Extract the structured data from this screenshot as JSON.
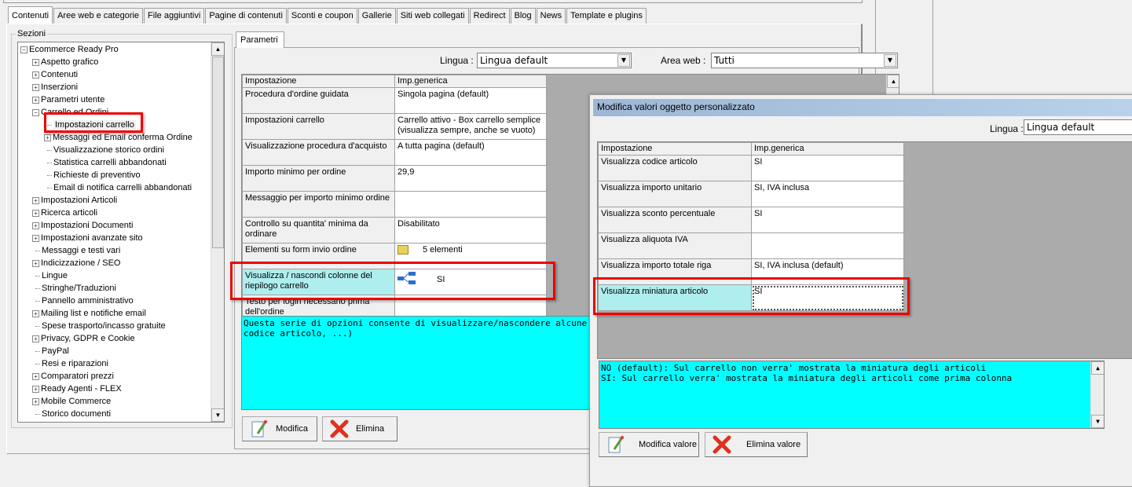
{
  "tabs": [
    "Contenuti",
    "Aree web e categorie",
    "File aggiuntivi",
    "Pagine di contenuti",
    "Sconti e coupon",
    "Gallerie",
    "Siti web collegati",
    "Redirect",
    "Blog",
    "News",
    "Template e plugins"
  ],
  "sections": {
    "label": "Sezioni",
    "root": "Ecommerce Ready Pro",
    "items": [
      {
        "label": "Aspetto grafico",
        "level": 1,
        "exp": "+"
      },
      {
        "label": "Contenuti",
        "level": 1,
        "exp": "+"
      },
      {
        "label": "Inserzioni",
        "level": 1,
        "exp": "+"
      },
      {
        "label": "Parametri utente",
        "level": 1,
        "exp": "+"
      },
      {
        "label": "Carrello ed Ordini",
        "level": 1,
        "exp": "-"
      },
      {
        "label": "Impostazioni carrello",
        "level": 2,
        "exp": "",
        "selected": true
      },
      {
        "label": "Messaggi ed Email conferma Ordine",
        "level": 2,
        "exp": "+"
      },
      {
        "label": "Visualizzazione storico ordini",
        "level": 2,
        "exp": ""
      },
      {
        "label": "Statistica carrelli abbandonati",
        "level": 2,
        "exp": ""
      },
      {
        "label": "Richieste di preventivo",
        "level": 2,
        "exp": ""
      },
      {
        "label": "Email di notifica carrelli abbandonati",
        "level": 2,
        "exp": ""
      },
      {
        "label": "Impostazioni Articoli",
        "level": 1,
        "exp": "+"
      },
      {
        "label": "Ricerca articoli",
        "level": 1,
        "exp": "+"
      },
      {
        "label": "Impostazioni Documenti",
        "level": 1,
        "exp": "+"
      },
      {
        "label": "Impostazioni avanzate sito",
        "level": 1,
        "exp": "+"
      },
      {
        "label": "Messaggi e testi vari",
        "level": 1,
        "exp": ""
      },
      {
        "label": "Indicizzazione / SEO",
        "level": 1,
        "exp": "+"
      },
      {
        "label": "Lingue",
        "level": 1,
        "exp": ""
      },
      {
        "label": "Stringhe/Traduzioni",
        "level": 1,
        "exp": ""
      },
      {
        "label": "Pannello amministrativo",
        "level": 1,
        "exp": ""
      },
      {
        "label": "Mailing list e notifiche email",
        "level": 1,
        "exp": "+"
      },
      {
        "label": "Spese trasporto/incasso gratuite",
        "level": 1,
        "exp": ""
      },
      {
        "label": "Privacy, GDPR e Cookie",
        "level": 1,
        "exp": "+"
      },
      {
        "label": "PayPal",
        "level": 1,
        "exp": ""
      },
      {
        "label": "Resi e riparazioni",
        "level": 1,
        "exp": ""
      },
      {
        "label": "Comparatori prezzi",
        "level": 1,
        "exp": "+"
      },
      {
        "label": "Ready Agenti - FLEX",
        "level": 1,
        "exp": "+"
      },
      {
        "label": "Mobile Commerce",
        "level": 1,
        "exp": "+"
      },
      {
        "label": "Storico documenti",
        "level": 1,
        "exp": ""
      }
    ]
  },
  "params": {
    "tab": "Parametri",
    "lingua_label": "Lingua :",
    "lingua_value": "Lingua default",
    "area_label": "Area web :",
    "area_value": "Tutti",
    "headers": [
      "Impostazione",
      "Imp.generica"
    ],
    "rows": [
      {
        "name": "Procedura d'ordine guidata",
        "value": "Singola pagina (default)"
      },
      {
        "name": "Impostazioni carrello",
        "value": "Carrello attivo - Box carrello semplice (visualizza sempre, anche se vuoto)"
      },
      {
        "name": "Visualizzazione procedura d'acquisto",
        "value": "A tutta pagina (default)"
      },
      {
        "name": "Importo minimo per ordine",
        "value": "29,9"
      },
      {
        "name": "Messaggio per importo minimo ordine",
        "value": ""
      },
      {
        "name": "Controllo su quantita' minima da ordinare",
        "value": "Disabilitato"
      },
      {
        "name": "Elementi su form invio ordine",
        "value": "5 elementi",
        "icon": "folder"
      },
      {
        "name": "Visualizza / nascondi colonne del riepilogo carrello",
        "value": "SI",
        "icon": "tree",
        "selected": true
      },
      {
        "name": "Testo per login necessario prima dell'ordine",
        "value": ""
      }
    ],
    "description": [
      "Questa serie di opzioni consente di visualizzare/nascondere alcune colonne s",
      "codice articolo, ...)"
    ],
    "modifica": "Modifica",
    "elimina": "Elimina"
  },
  "dialog": {
    "title": "Modifica valori oggetto personalizzato",
    "lingua_label": "Lingua :",
    "lingua_value": "Lingua default",
    "headers": [
      "Impostazione",
      "Imp.generica"
    ],
    "rows": [
      {
        "name": "Visualizza codice articolo",
        "value": "SI"
      },
      {
        "name": "Visualizza importo unitario",
        "value": "SI, IVA inclusa"
      },
      {
        "name": "Visualizza sconto percentuale",
        "value": "SI"
      },
      {
        "name": "Visualizza aliquota IVA",
        "value": ""
      },
      {
        "name": "Visualizza importo totale riga",
        "value": "SI, IVA inclusa (default)"
      },
      {
        "name": "Visualizza miniatura articolo",
        "value": "SI",
        "selected": true
      }
    ],
    "description": [
      "NO (default): Sul carrello non verra' mostrata la miniatura degli articoli",
      "SI: Sul carrello verra' mostrata la miniatura degli articoli come prima colonna"
    ],
    "modifica": "Modifica valore",
    "elimina": "Elimina valore"
  },
  "colors": {
    "highlight": "#ff0000",
    "description_bg": "#00ffff",
    "selected_row": "#aeeeee"
  }
}
